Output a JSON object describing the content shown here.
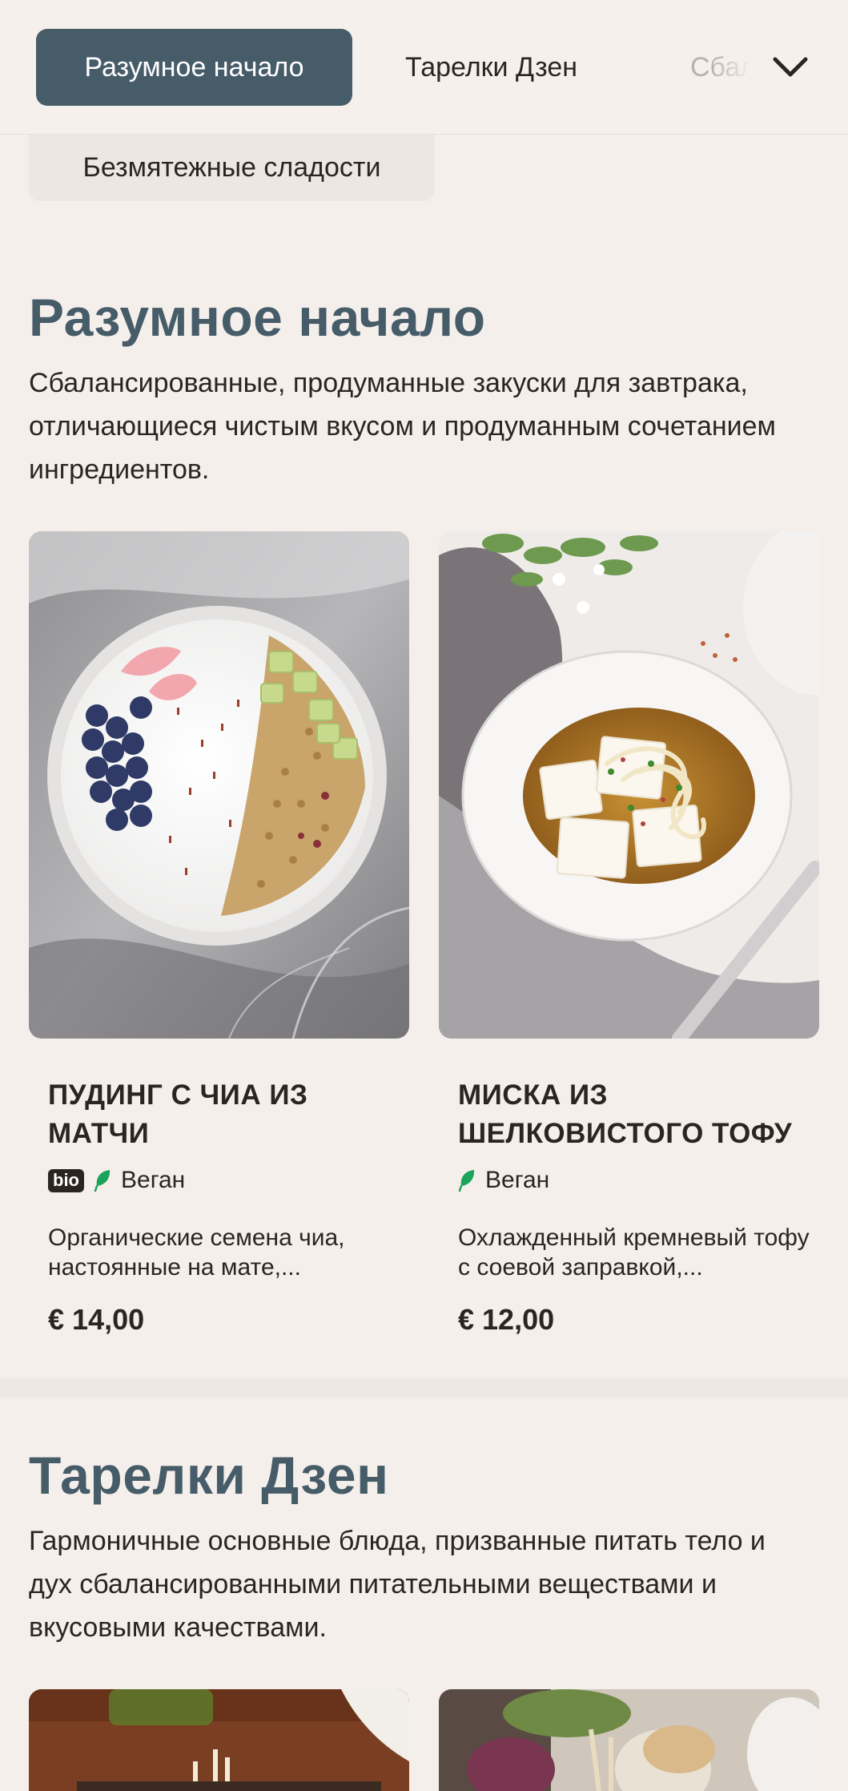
{
  "nav": {
    "tabs": [
      {
        "label": "Разумное начало",
        "active": true
      },
      {
        "label": "Тарелки Дзен",
        "active": false
      },
      {
        "label": "Сбалансированные",
        "active": false
      }
    ],
    "more_icon": "chevron-down-icon",
    "overflow_chip": "Безмятежные сладости"
  },
  "sections": [
    {
      "title": "Разумное начало",
      "description": "Сбалансированные, продуманные закуски для завтрака, отличающиеся чистым вкусом и продуманным сочетанием ингредиентов.",
      "items": [
        {
          "name": "ПУДИНГ С ЧИА ИЗ МАТЧИ",
          "bio_badge": "bio",
          "tag": "Веган",
          "description": "Органические семена чиа, настоянные на мате,...",
          "price": "€ 14,00"
        },
        {
          "name": "МИСКА ИЗ ШЕЛКОВИСТОГО ТОФУ",
          "tag": "Веган",
          "description": "Охлажденный кремневый тофу с соевой заправкой,...",
          "price": "€ 12,00"
        }
      ]
    },
    {
      "title": "Тарелки Дзен",
      "description": "Гармоничные основные блюда, призванные питать тело и дух сбалансированными питательными веществами и вкусовыми качествами."
    }
  ],
  "colors": {
    "background": "#f5efeb",
    "accent": "#475c69",
    "vegan_leaf": "#1aa35a"
  }
}
